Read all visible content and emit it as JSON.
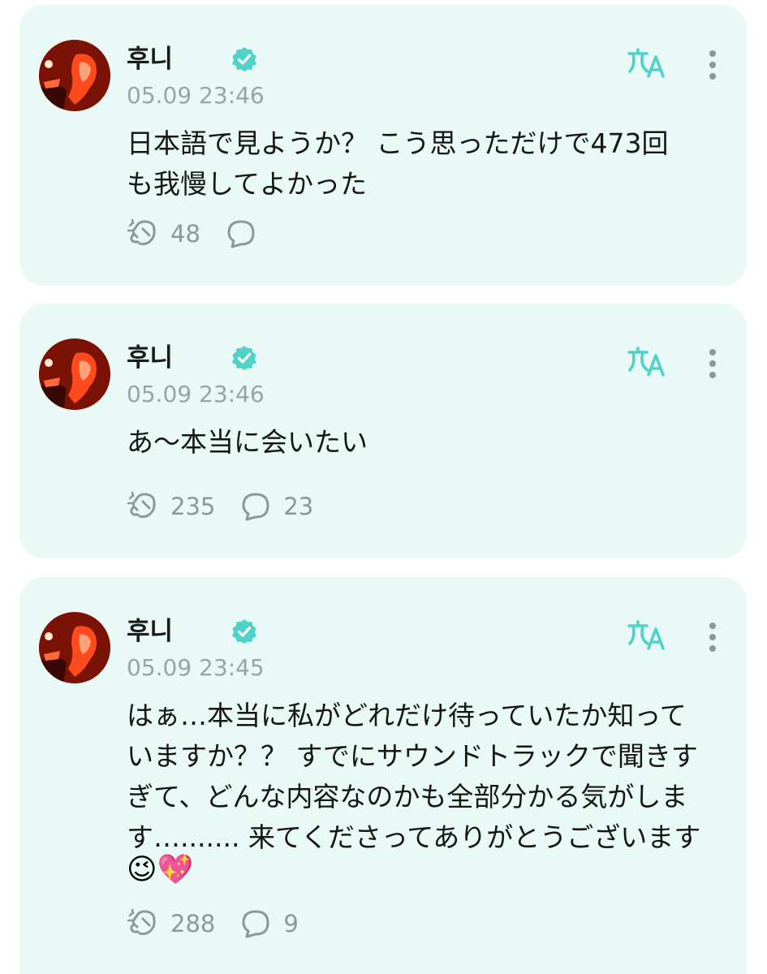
{
  "posts": [
    {
      "author": "후니",
      "time": "05.09 23:46",
      "text": "日本語で見ようか？ こう思っただけで473回\nも我慢してよかった",
      "emoji": "",
      "cheer_count": "48",
      "comment_count": ""
    },
    {
      "author": "후니",
      "time": "05.09 23:46",
      "text": "あ～本当に会いたい",
      "emoji": "",
      "cheer_count": "235",
      "comment_count": "23"
    },
    {
      "author": "후니",
      "time": "05.09 23:45",
      "text": "はぁ…本当に私がどれだけ待っていたか知って\nいますか？？ すでにサウンドトラックで聞きす\nぎて、どんな内容なのかも全部分かる気がしま\nす…....... 来てくださってありがとうございます",
      "emoji": "😉💖",
      "cheer_count": "288",
      "comment_count": "9"
    }
  ],
  "icons": {
    "verified": "verified-badge-icon",
    "translate": "translate-icon",
    "more": "more-vertical-icon",
    "cheer": "cheer-hand-icon",
    "comment": "comment-bubble-icon"
  },
  "colors": {
    "card_bg": "#e9f9f6",
    "accent": "#4fd3c8",
    "muted": "#9aa5a3",
    "text": "#161616"
  }
}
